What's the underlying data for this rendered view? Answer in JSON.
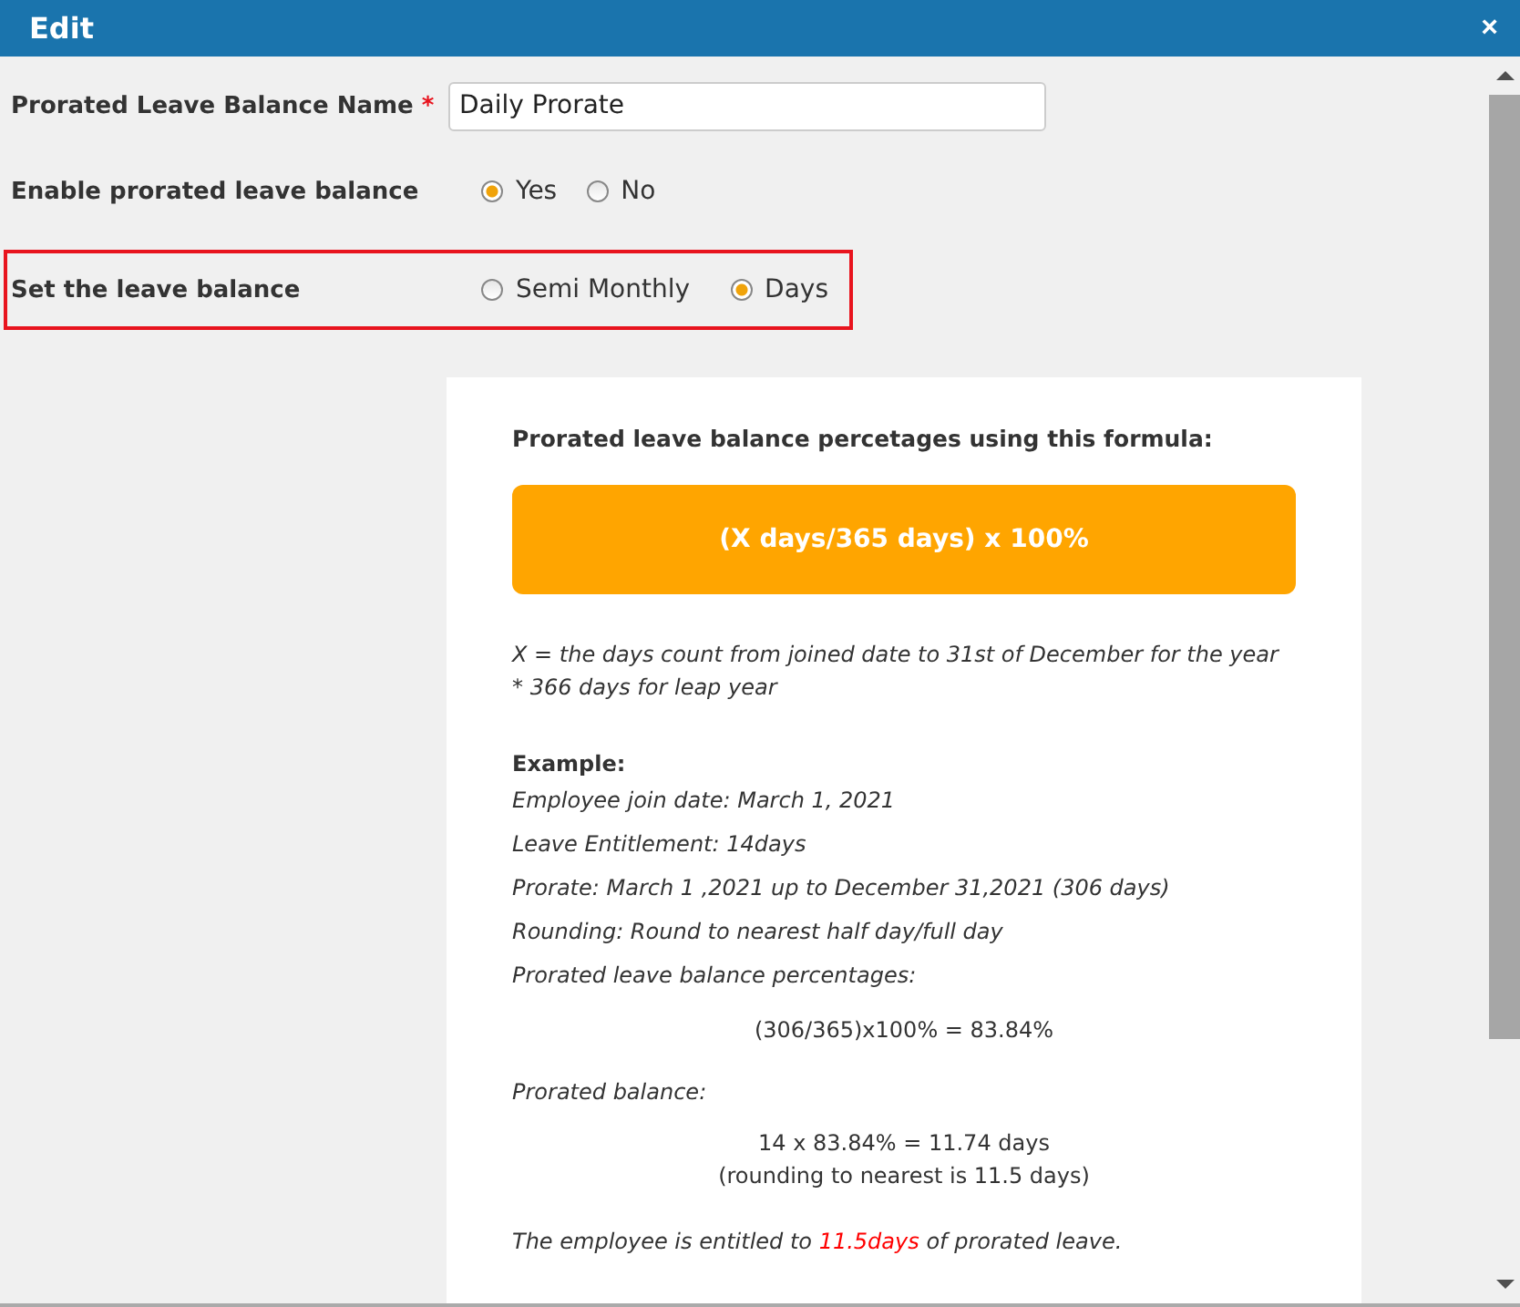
{
  "window": {
    "title": "Edit",
    "close": "×"
  },
  "fields": [
    {
      "kind": "text",
      "label": "Prorated Leave Balance Name",
      "required_mark": "*",
      "value": "Daily Prorate"
    },
    {
      "kind": "radio",
      "label": "Enable prorated leave balance",
      "highlighted": false,
      "options": [
        {
          "label": "Yes",
          "selected": true
        },
        {
          "label": "No",
          "selected": false
        }
      ]
    },
    {
      "kind": "radio",
      "label": "Set the leave balance",
      "highlighted": true,
      "options": [
        {
          "label": "Semi Monthly",
          "selected": false
        },
        {
          "label": "Days",
          "selected": true
        }
      ]
    }
  ],
  "info": {
    "heading": "Prorated leave balance percetages using this formula:",
    "formula": "(X days/365 days) x 100%",
    "lines": [
      {
        "kind": "note",
        "text": "X = the days count from joined date to 31st of December for the year"
      },
      {
        "kind": "note",
        "text": "* 366 days for leap year"
      },
      {
        "kind": "heading",
        "text": "Example:"
      },
      {
        "kind": "item",
        "text": "Employee join date: March 1, 2021"
      },
      {
        "kind": "item",
        "text": "Leave Entitlement: 14days"
      },
      {
        "kind": "item",
        "text": "Prorate: March 1 ,2021 up to December 31,2021 (306 days)"
      },
      {
        "kind": "item",
        "text": "Rounding: Round to nearest half day/full day"
      },
      {
        "kind": "item",
        "text": "Prorated leave balance percentages:"
      },
      {
        "kind": "center",
        "text": "(306/365)x100% = 83.84%"
      },
      {
        "kind": "label",
        "text": "Prorated balance:"
      },
      {
        "kind": "center",
        "text": "14 x 83.84% = 11.74 days"
      },
      {
        "kind": "center2",
        "text": "(rounding to nearest is 11.5 days)"
      }
    ],
    "result": {
      "before": "The employee is entitled to ",
      "highlight": "11.5days",
      "after": " of prorated leave."
    }
  }
}
